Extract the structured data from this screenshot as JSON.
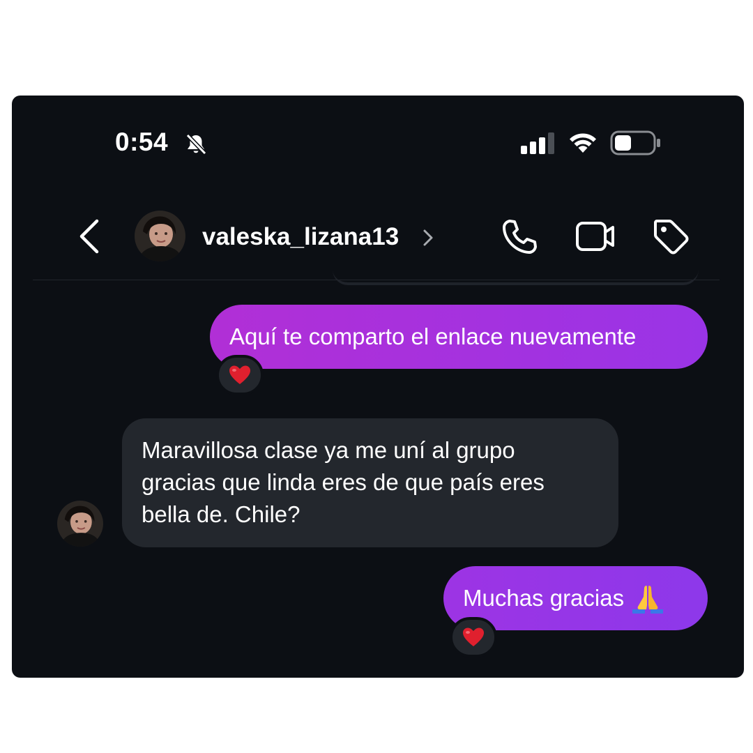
{
  "status_bar": {
    "time": "0:54",
    "icons": [
      "bell-slash-icon",
      "signal-icon",
      "wifi-icon",
      "battery-icon"
    ],
    "battery_level": 0.45
  },
  "header": {
    "back_icon": "chevron-left-icon",
    "username": "valeska_lizana13",
    "actions": [
      "phone-icon",
      "video-camera-icon",
      "tag-icon"
    ]
  },
  "messages": [
    {
      "direction": "outgoing",
      "text": "Aquí te comparto el enlace nuevamente",
      "reaction": "heart"
    },
    {
      "direction": "incoming",
      "lines": [
        "Maravillosa clase ya me uní al grupo",
        "gracias que linda eres de que país eres",
        "bella de. Chile?"
      ]
    },
    {
      "direction": "outgoing",
      "text": "Muchas gracias",
      "emoji": "folded-hands",
      "reaction": "heart"
    }
  ],
  "colors": {
    "background": "#0c0f14",
    "outgoing_bubble": "#b12fd6",
    "incoming_bubble": "#23272d",
    "reaction_heart": "#e0202e"
  }
}
